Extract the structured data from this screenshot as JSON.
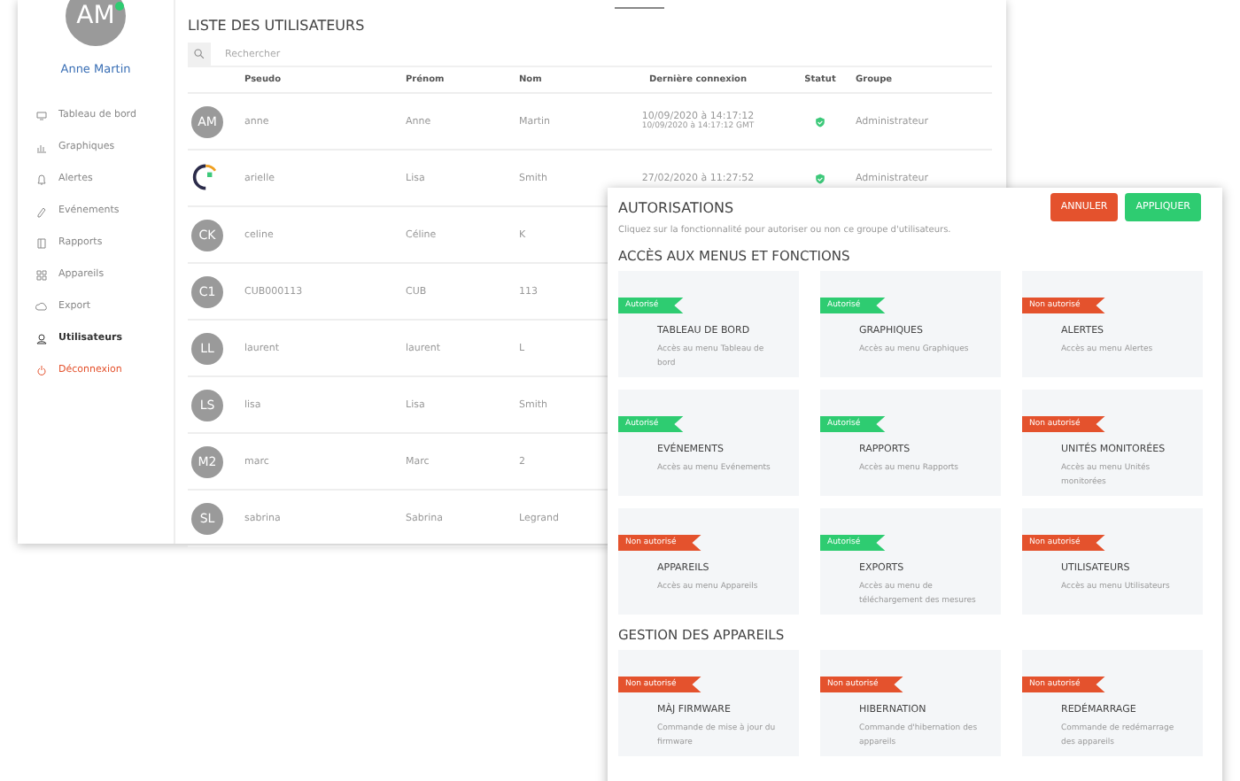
{
  "profile": {
    "initials": "AM",
    "online": true,
    "name": "Anne Martin"
  },
  "sidebar": {
    "items": [
      {
        "label": "Tableau de bord",
        "selected": false,
        "kind": "menu"
      },
      {
        "label": "Graphiques",
        "selected": false,
        "kind": "menu"
      },
      {
        "label": "Alertes",
        "selected": false,
        "kind": "menu"
      },
      {
        "label": "Evénements",
        "selected": false,
        "kind": "menu"
      },
      {
        "label": "Rapports",
        "selected": false,
        "kind": "menu"
      },
      {
        "label": "Appareils",
        "selected": false,
        "kind": "menu"
      },
      {
        "label": "Export",
        "selected": false,
        "kind": "menu"
      },
      {
        "label": "Utilisateurs",
        "selected": true,
        "kind": "menu"
      },
      {
        "label": "Déconnexion",
        "selected": false,
        "kind": "logout"
      }
    ]
  },
  "users": {
    "title": "LISTE DES UTILISATEURS",
    "search": {
      "placeholder": "Rechercher"
    },
    "columns": [
      "Pseudo",
      "Prénom",
      "Nom",
      "Dernière connexion",
      "Statut",
      "Groupe"
    ],
    "rows": [
      {
        "avatar": {
          "kind": "initials",
          "text": "AM"
        },
        "pseudo": "anne",
        "prenom": "Anne",
        "nom": "Martin",
        "last_login": "10/09/2020 à 14:17:12",
        "last_login_detail": "10/09/2020 à 14:17:12 GMT",
        "active": true,
        "group": "Administrateur"
      },
      {
        "avatar": {
          "kind": "image"
        },
        "pseudo": "arielle",
        "prenom": "Lisa",
        "nom": "Smith",
        "last_login": "27/02/2020 à 11:27:52",
        "active": true,
        "group": "Administrateur"
      },
      {
        "avatar": {
          "kind": "initials",
          "text": "CK"
        },
        "pseudo": "celine",
        "prenom": "Céline",
        "nom": "K"
      },
      {
        "avatar": {
          "kind": "initials",
          "text": "C1"
        },
        "pseudo": "CUB000113",
        "prenom": "CUB",
        "nom": "113"
      },
      {
        "avatar": {
          "kind": "initials",
          "text": "LL"
        },
        "pseudo": "laurent",
        "prenom": "laurent",
        "nom": "L"
      },
      {
        "avatar": {
          "kind": "initials",
          "text": "LS"
        },
        "pseudo": "lisa",
        "prenom": "Lisa",
        "nom": "Smith"
      },
      {
        "avatar": {
          "kind": "initials",
          "text": "M2"
        },
        "pseudo": "marc",
        "prenom": "Marc",
        "nom": "2"
      },
      {
        "avatar": {
          "kind": "initials",
          "text": "SL"
        },
        "pseudo": "sabrina",
        "prenom": "Sabrina",
        "nom": "Legrand"
      }
    ]
  },
  "permissions": {
    "title": "AUTORISATIONS",
    "buttons": [
      {
        "label": "ANNULER",
        "kind": "cancel"
      },
      {
        "label": "APPLIQUER",
        "kind": "apply"
      }
    ],
    "subtitle": "Cliquez sur la fonctionnalité pour autoriser ou non ce groupe d'utilisateurs.",
    "sections": [
      {
        "heading": "ACCÈS AUX MENUS ET FONCTIONS",
        "cards": [
          {
            "badge": "Autorisé",
            "allowed": true,
            "title": "TABLEAU DE BORD",
            "description": "Accès au menu Tableau de bord"
          },
          {
            "badge": "Autorisé",
            "allowed": true,
            "title": "GRAPHIQUES",
            "description": "Accès au menu Graphiques"
          },
          {
            "badge": "Non autorisé",
            "allowed": false,
            "title": "ALERTES",
            "description": "Accès au menu Alertes"
          },
          {
            "badge": "Autorisé",
            "allowed": true,
            "title": "EVÉNEMENTS",
            "description": "Accès au menu Evénements"
          },
          {
            "badge": "Autorisé",
            "allowed": true,
            "title": "RAPPORTS",
            "description": "Accès au menu Rapports"
          },
          {
            "badge": "Non autorisé",
            "allowed": false,
            "title": "UNITÉS MONITORÉES",
            "description": "Accès au menu Unités monitorées"
          },
          {
            "badge": "Non autorisé",
            "allowed": false,
            "title": "APPAREILS",
            "description": "Accès au menu Appareils"
          },
          {
            "badge": "Autorisé",
            "allowed": true,
            "title": "EXPORTS",
            "description": "Accès au menu de téléchargement des mesures"
          },
          {
            "badge": "Non autorisé",
            "allowed": false,
            "title": "UTILISATEURS",
            "description": "Accès au menu Utilisateurs"
          }
        ]
      },
      {
        "heading": "GESTION DES APPAREILS",
        "cards": [
          {
            "badge": "Non autorisé",
            "allowed": false,
            "title": "MÀJ FIRMWARE",
            "description": "Commande de mise à jour du firmware"
          },
          {
            "badge": "Non autorisé",
            "allowed": false,
            "title": "HIBERNATION",
            "description": "Commande d'hibernation des appareils"
          },
          {
            "badge": "Non autorisé",
            "allowed": false,
            "title": "REDÉMARRAGE",
            "description": "Commande de redémarrage des appareils"
          }
        ]
      }
    ]
  }
}
